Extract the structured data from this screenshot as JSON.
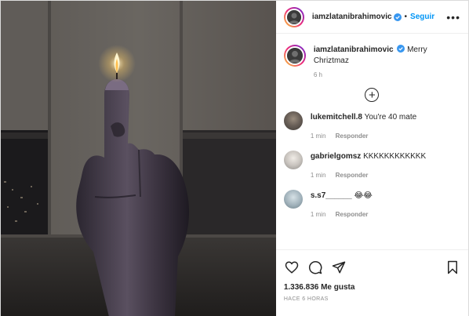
{
  "author": {
    "username": "iamzlatanibrahimovic",
    "follow_label": "Seguir",
    "more_label": "•••"
  },
  "caption": {
    "username": "iamzlatanibrahimovic",
    "text": "Merry Chriztmaz",
    "time": "6 h"
  },
  "comments": [
    {
      "username": "lukemitchell.8",
      "text": "You're 40 mate",
      "time": "1 min",
      "reply_label": "Responder"
    },
    {
      "username": "gabrielgomsz",
      "text": "KKKKKKKKKKKK",
      "time": "1 min",
      "reply_label": "Responder"
    },
    {
      "username": "s.s7______",
      "text": "😂😂",
      "time": "1 min",
      "reply_label": "Responder"
    }
  ],
  "load_more_label": "+",
  "likes": "1.336.836 Me gusta",
  "timestamp": "HACE 6 HORAS",
  "icons": {
    "like": "heart-icon",
    "comment": "comment-bubble-icon",
    "share": "paper-plane-icon",
    "save": "bookmark-icon",
    "verified": "verified-badge-icon",
    "load_more": "plus-circle-icon",
    "more": "more-options-icon"
  },
  "colors": {
    "accent": "#0095f6",
    "text": "#262626",
    "muted": "#8e8e8e"
  }
}
